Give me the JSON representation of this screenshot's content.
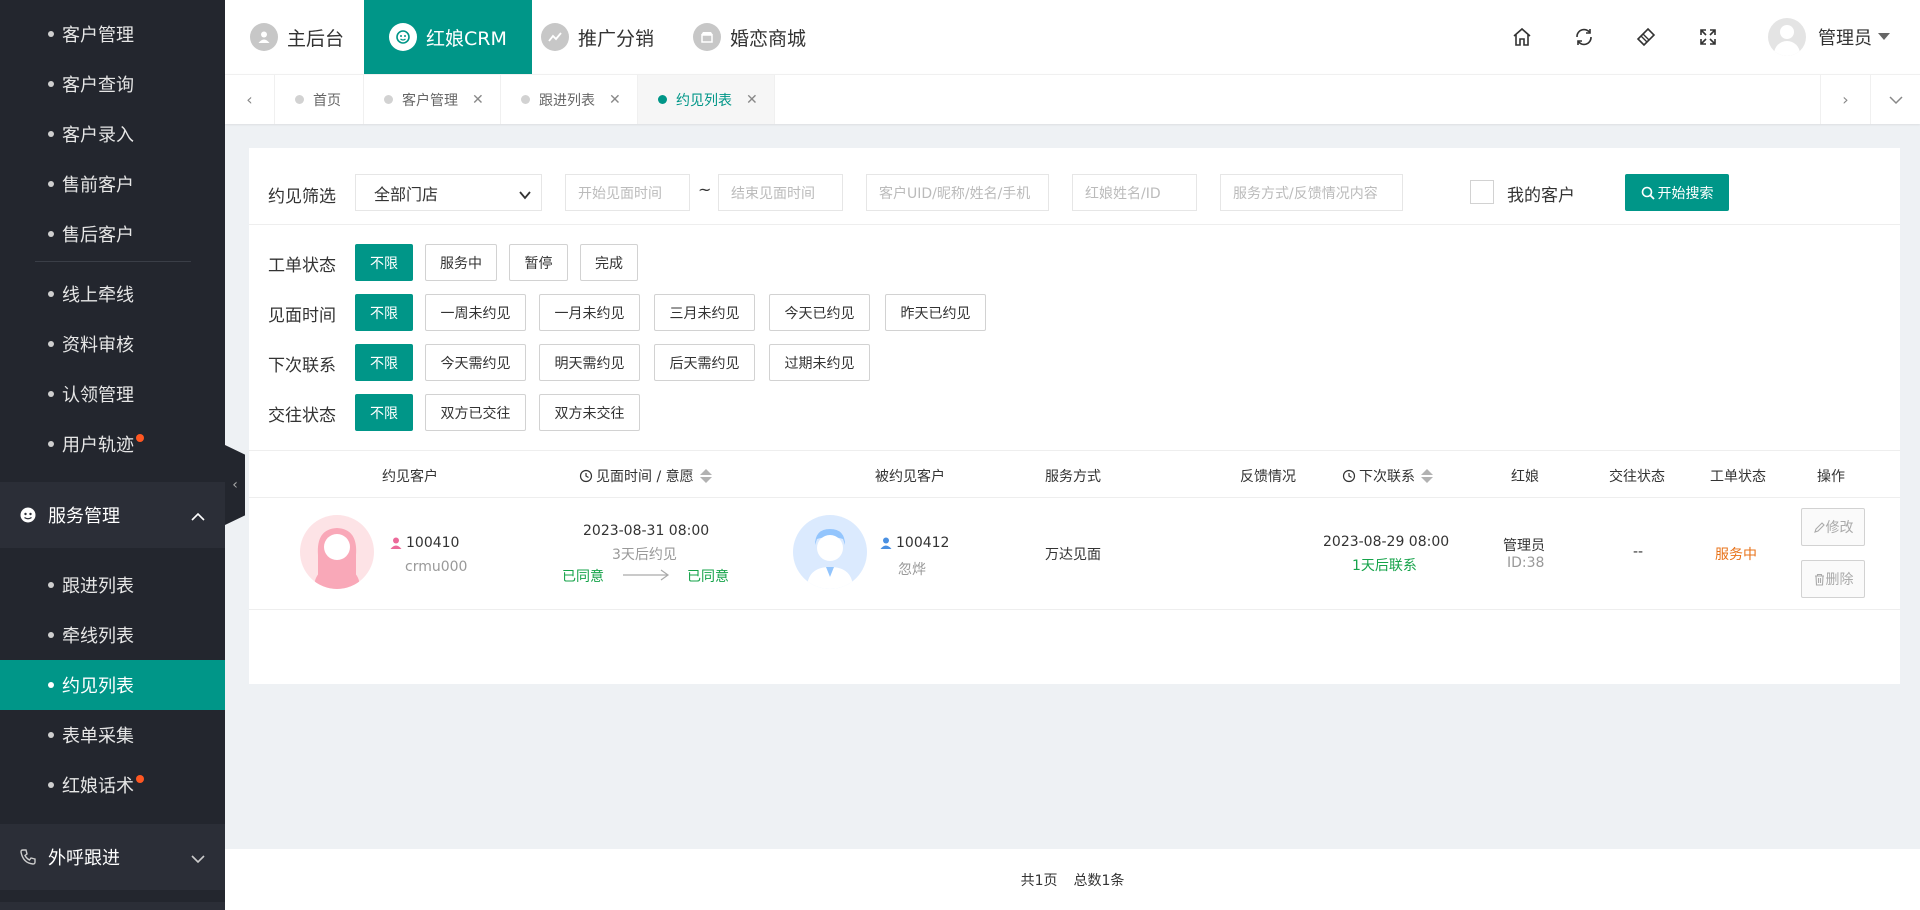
{
  "sidebar": {
    "items_top": [
      {
        "label": "客户管理"
      },
      {
        "label": "客户查询"
      },
      {
        "label": "客户录入"
      },
      {
        "label": "售前客户"
      },
      {
        "label": "售后客户"
      }
    ],
    "items_mid": [
      {
        "label": "线上牵线"
      },
      {
        "label": "资料审核"
      },
      {
        "label": "认领管理"
      },
      {
        "label": "用户轨迹"
      }
    ],
    "service_group": {
      "label": "服务管理"
    },
    "service_items": [
      {
        "label": "跟进列表"
      },
      {
        "label": "牵线列表"
      },
      {
        "label": "约见列表"
      },
      {
        "label": "表单采集"
      },
      {
        "label": "红娘话术"
      }
    ],
    "call_group": {
      "label": "外呼跟进"
    }
  },
  "header": {
    "modules": [
      {
        "label": "主后台"
      },
      {
        "label": "红娘CRM"
      },
      {
        "label": "推广分销"
      },
      {
        "label": "婚恋商城"
      }
    ],
    "user_name": "管理员"
  },
  "page_tabs": [
    {
      "label": "首页"
    },
    {
      "label": "客户管理"
    },
    {
      "label": "跟进列表"
    },
    {
      "label": "约见列表"
    }
  ],
  "filter": {
    "title": "约见筛选",
    "store_select": "全部门店",
    "start_time_placeholder": "开始见面时间",
    "separator": "~",
    "end_time_placeholder": "结束见面时间",
    "customer_placeholder": "客户UID/昵称/姓名/手机",
    "matchmaker_placeholder": "红娘姓名/ID",
    "service_placeholder": "服务方式/反馈情况内容",
    "my_customer_label": "我的客户",
    "search_button": "开始搜索"
  },
  "filter_rows": [
    {
      "label": "工单状态",
      "options": [
        "不限",
        "服务中",
        "暂停",
        "完成"
      ]
    },
    {
      "label": "见面时间",
      "options": [
        "不限",
        "一周未约见",
        "一月未约见",
        "三月未约见",
        "今天已约见",
        "昨天已约见"
      ]
    },
    {
      "label": "下次联系",
      "options": [
        "不限",
        "今天需约见",
        "明天需约见",
        "后天需约见",
        "过期未约见"
      ]
    },
    {
      "label": "交往状态",
      "options": [
        "不限",
        "双方已交往",
        "双方未交往"
      ]
    }
  ],
  "table": {
    "headers": {
      "customer": "约见客户",
      "meet_time": "见面时间 / 意愿",
      "target": "被约见客户",
      "service": "服务方式",
      "feedback": "反馈情况",
      "next_contact": "下次联系",
      "matchmaker": "红娘",
      "relation": "交往状态",
      "order_status": "工单状态",
      "actions": "操作"
    },
    "row": {
      "customer_uid": "100410",
      "customer_name": "crmu000",
      "meet_datetime": "2023-08-31 08:00",
      "meet_relative": "3天后约见",
      "intent_left": "已同意",
      "intent_right": "已同意",
      "target_uid": "100412",
      "target_name": "忽烨",
      "service": "万达见面",
      "feedback": "",
      "next_datetime": "2023-08-29 08:00",
      "next_relative": "1天后联系",
      "matchmaker_name": "管理员",
      "matchmaker_id": "ID:38",
      "relation": "--",
      "order_status": "服务中",
      "edit_label": "修改",
      "delete_label": "删除"
    }
  },
  "pagination": {
    "pages": "共1页",
    "total": "总数1条"
  },
  "colors": {
    "accent": "#009688",
    "sidebar_bg": "#23262e",
    "badge": "#ff5722",
    "agree": "#16a34a",
    "status_serving": "#e8731a"
  }
}
